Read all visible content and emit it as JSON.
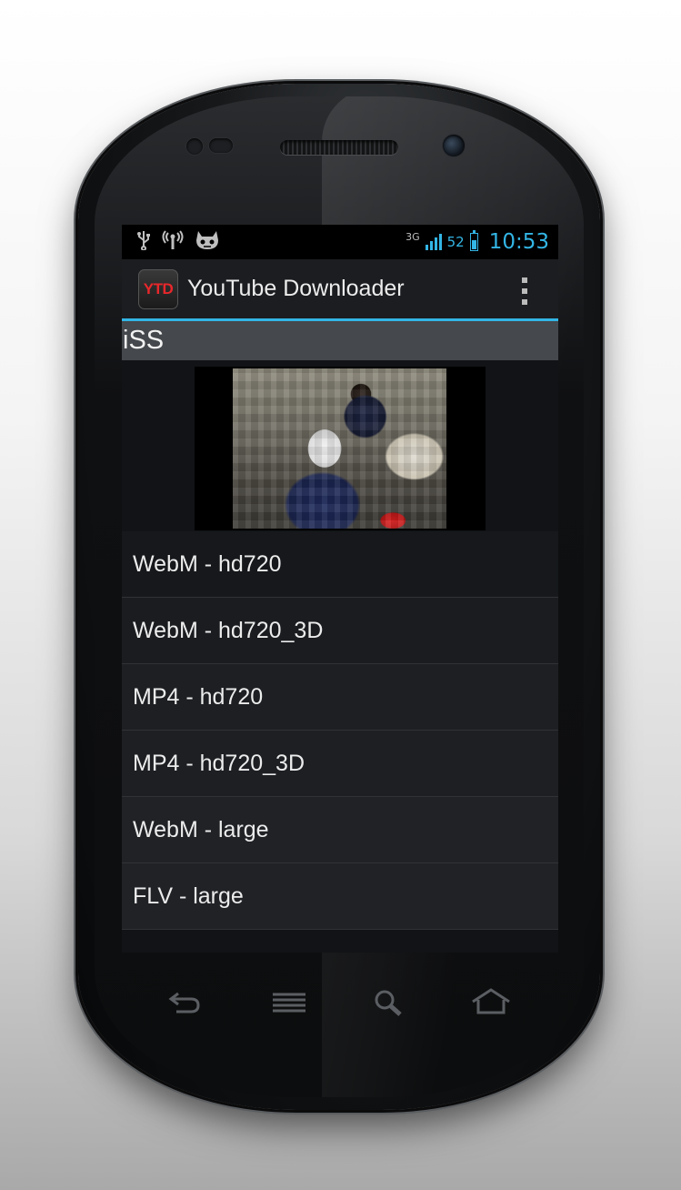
{
  "status_bar": {
    "network": "3G",
    "battery_percent": "52",
    "battery_level": 0.52,
    "clock": "10:53",
    "left_icons": [
      "usb-icon",
      "tethering-icon",
      "cyanogen-icon"
    ],
    "accent_color": "#33b5e5"
  },
  "action_bar": {
    "logo_text": "YTD",
    "title": "YouTube Downloader",
    "overflow_icon": "overflow-menu-icon"
  },
  "video": {
    "title": "iSS"
  },
  "formats": [
    "WebM - hd720",
    "WebM - hd720_3D",
    "MP4 - hd720",
    "MP4 - hd720_3D",
    "WebM - large",
    "FLV - large"
  ],
  "soft_keys": [
    "back-icon",
    "menu-icon",
    "search-icon",
    "home-icon"
  ]
}
